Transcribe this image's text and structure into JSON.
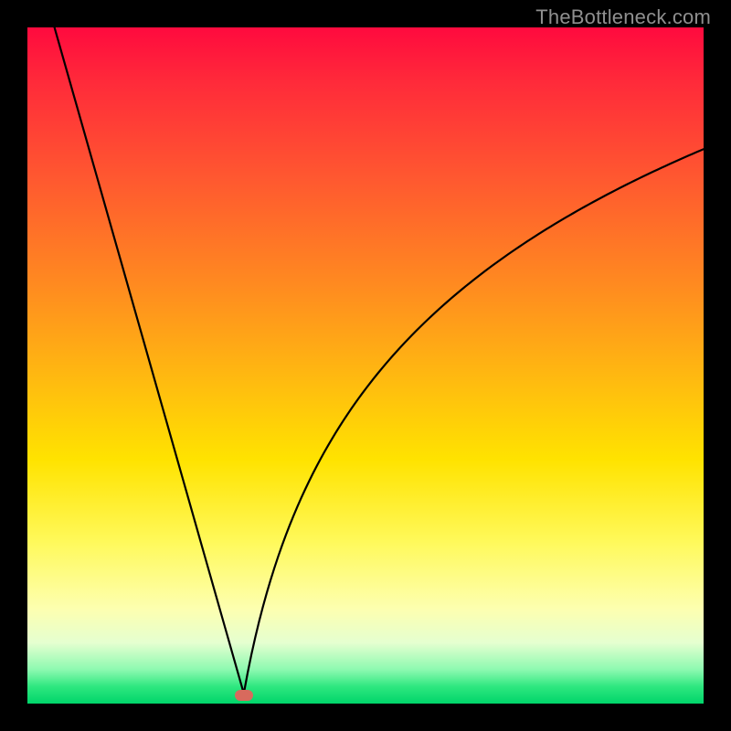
{
  "watermark": "TheBottleneck.com",
  "colors": {
    "frame": "#000000",
    "curve": "#000000",
    "marker": "#d86a5d"
  },
  "chart_data": {
    "type": "line",
    "title": "",
    "xlabel": "",
    "ylabel": "",
    "x_range": [
      0,
      100
    ],
    "y_range": [
      0,
      100
    ],
    "optimum_x": 32,
    "curve": {
      "description": "V-shaped bottleneck score: |x - 32| style. Left of optimum is a straight descent from top; right of optimum rises along a concave saturating arc.",
      "left": {
        "x": [
          4,
          32
        ],
        "y": [
          100,
          1.5
        ],
        "shape": "linear"
      },
      "right": {
        "x": [
          32,
          100
        ],
        "y": [
          1.5,
          82
        ],
        "shape": "concave-log"
      }
    },
    "marker": {
      "x": 32,
      "y": 1.2
    },
    "gradient_stops": [
      {
        "pct": 0,
        "color": "#ff0a3e"
      },
      {
        "pct": 22,
        "color": "#ff5730"
      },
      {
        "pct": 52,
        "color": "#ffba10"
      },
      {
        "pct": 76,
        "color": "#fff95a"
      },
      {
        "pct": 95,
        "color": "#8cf9b0"
      },
      {
        "pct": 100,
        "color": "#00d56a"
      }
    ]
  }
}
